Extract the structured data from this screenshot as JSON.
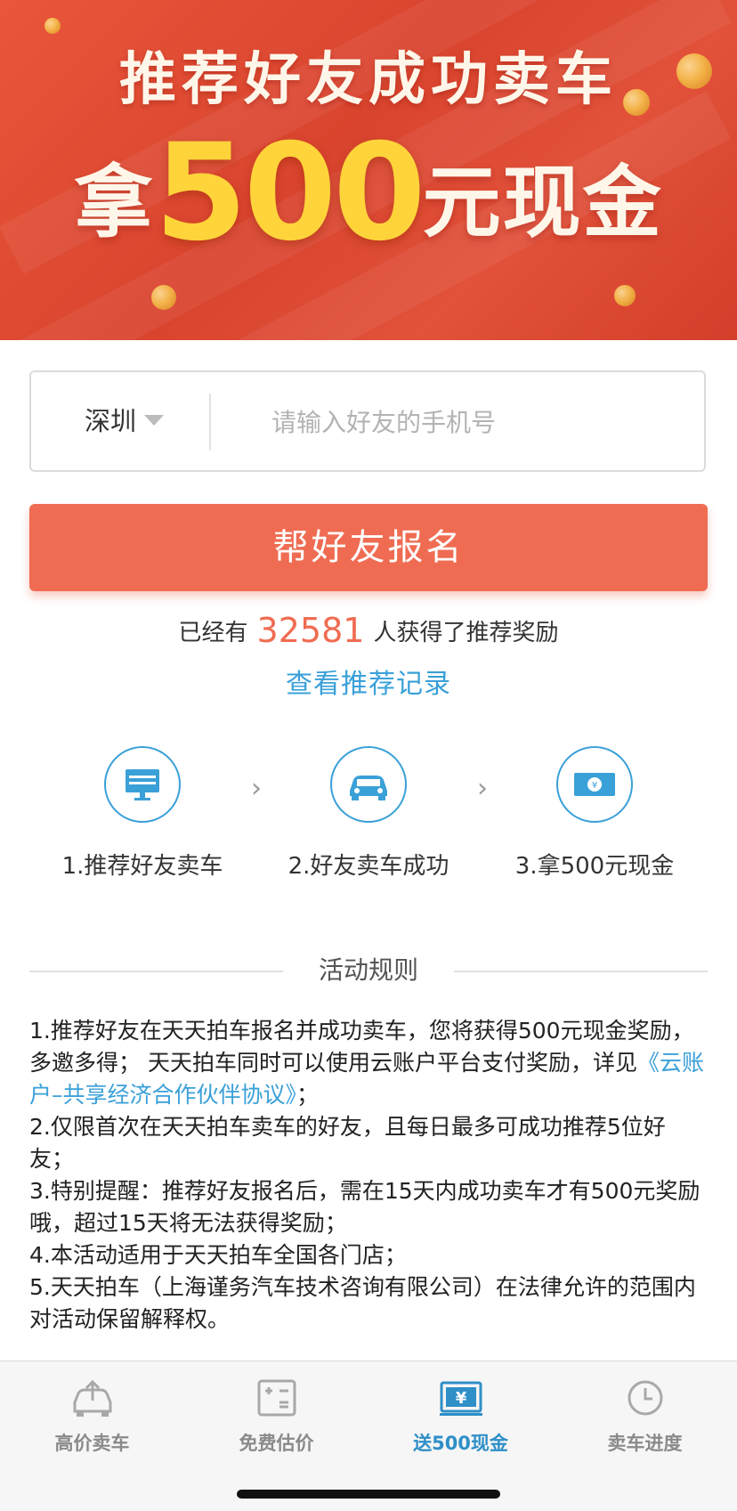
{
  "banner": {
    "line1": "推荐好友成功卖车",
    "line2_prefix": "拿",
    "line2_amount": "500",
    "line2_suffix": "元现金"
  },
  "form": {
    "city": "深圳",
    "phone_placeholder": "请输入好友的手机号",
    "submit_label": "帮好友报名"
  },
  "stats": {
    "prefix": "已经有",
    "count": "32581",
    "suffix": "人获得了推荐奖励"
  },
  "record_link": "查看推荐记录",
  "steps": [
    {
      "label": "1.推荐好友卖车",
      "icon": "monitor-icon"
    },
    {
      "label": "2.好友卖车成功",
      "icon": "car-icon"
    },
    {
      "label": "3.拿500元现金",
      "icon": "cash-icon"
    }
  ],
  "rules": {
    "title": "活动规则",
    "r1_text": "1.推荐好友在天天拍车报名并成功卖车，您将获得500元现金奖励，多邀多得； 天天拍车同时可以使用云账户平台支付奖励，详见",
    "r1_link": "《云账户–共享经济合作伙伴协议》",
    "r1_end": "；",
    "r2": "2.仅限首次在天天拍车卖车的好友，且每日最多可成功推荐5位好友；",
    "r3": "3.特别提醒：推荐好友报名后，需在15天内成功卖车才有500元奖励哦，超过15天将无法获得奖励；",
    "r4": "4.本活动适用于天天拍车全国各门店；",
    "r5": "5.天天拍车（上海谨务汽车技术咨询有限公司）在法律允许的范围内对活动保留解释权。"
  },
  "tabbar": {
    "tabs": [
      {
        "label": "高价卖车",
        "icon": "car-upload-icon"
      },
      {
        "label": "免费估价",
        "icon": "calculator-icon"
      },
      {
        "label": "送500现金",
        "icon": "yen-cash-icon"
      },
      {
        "label": "卖车进度",
        "icon": "clock-icon"
      }
    ],
    "active_index": 2,
    "active_color": "#2f8fc7"
  },
  "colors": {
    "accent": "#ef6c52",
    "link": "#3aa0d8"
  }
}
